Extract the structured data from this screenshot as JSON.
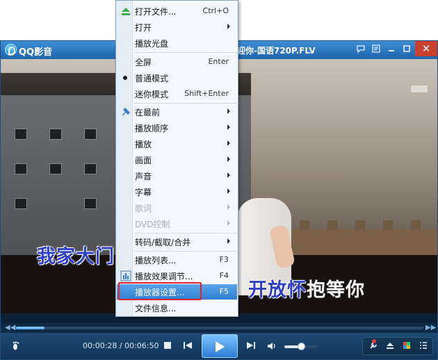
{
  "window": {
    "app_title": "QQ影音",
    "file_title": "迎你-国语720P.FLV",
    "close_symbol": "✕"
  },
  "video": {
    "subtitle_left": "我家大门",
    "subtitle_right_blue": "开放怀",
    "subtitle_right_white": "抱等你"
  },
  "player": {
    "time": "00:00:28 / 00:06:50",
    "progress_fraction": 0.07,
    "volume_fraction": 0.5
  },
  "menu": {
    "items": [
      {
        "label": "打开文件...",
        "shortcut": "Ctrl+O",
        "icon": "eject-icon"
      },
      {
        "label": "打开",
        "submenu": true
      },
      {
        "label": "播放光盘"
      },
      {
        "label": "全屏",
        "shortcut": "Enter"
      },
      {
        "label": "普通模式",
        "selected": true
      },
      {
        "label": "迷你模式",
        "shortcut": "Shift+Enter"
      },
      {
        "label": "在最前",
        "submenu": true,
        "icon": "pin-icon"
      },
      {
        "label": "播放顺序",
        "submenu": true
      },
      {
        "label": "播放",
        "submenu": true
      },
      {
        "label": "画面",
        "submenu": true
      },
      {
        "label": "声音",
        "submenu": true
      },
      {
        "label": "字幕",
        "submenu": true
      },
      {
        "label": "歌词",
        "submenu": true,
        "disabled": true
      },
      {
        "label": "DVD控制",
        "submenu": true,
        "disabled": true
      },
      {
        "label": "转码/截取/合并",
        "submenu": true
      },
      {
        "label": "播放列表...",
        "shortcut": "F3"
      },
      {
        "label": "播放效果调节...",
        "shortcut": "F4",
        "icon": "equalizer-icon"
      },
      {
        "label": "播放器设置...",
        "shortcut": "F5",
        "highlighted": true
      },
      {
        "label": "文件信息..."
      }
    ]
  },
  "colors": {
    "accent": "#2f7fd0",
    "highlight_box": "#e0262b",
    "subtitle_blue": "#2f3ec7"
  }
}
